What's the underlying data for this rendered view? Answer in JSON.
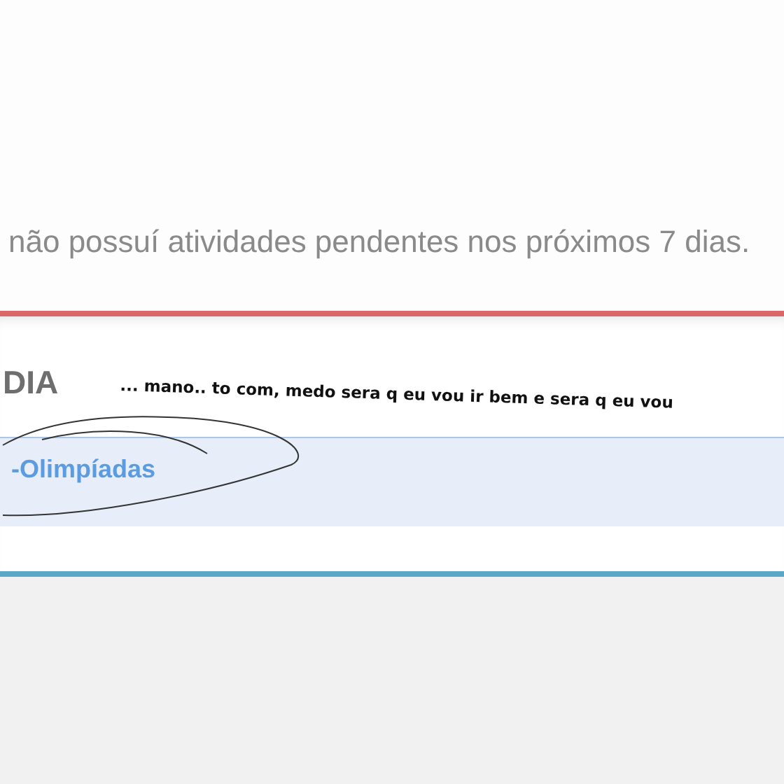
{
  "notice": {
    "text": "não possuí atividades pendentes nos próximos 7 dias."
  },
  "section": {
    "heading": "DIA",
    "annotation": "... mano.. to com, medo sera q eu vou ir bem e sera q eu vou",
    "items": [
      {
        "title": "-Olimpíadas",
        "selected": true
      }
    ]
  }
}
